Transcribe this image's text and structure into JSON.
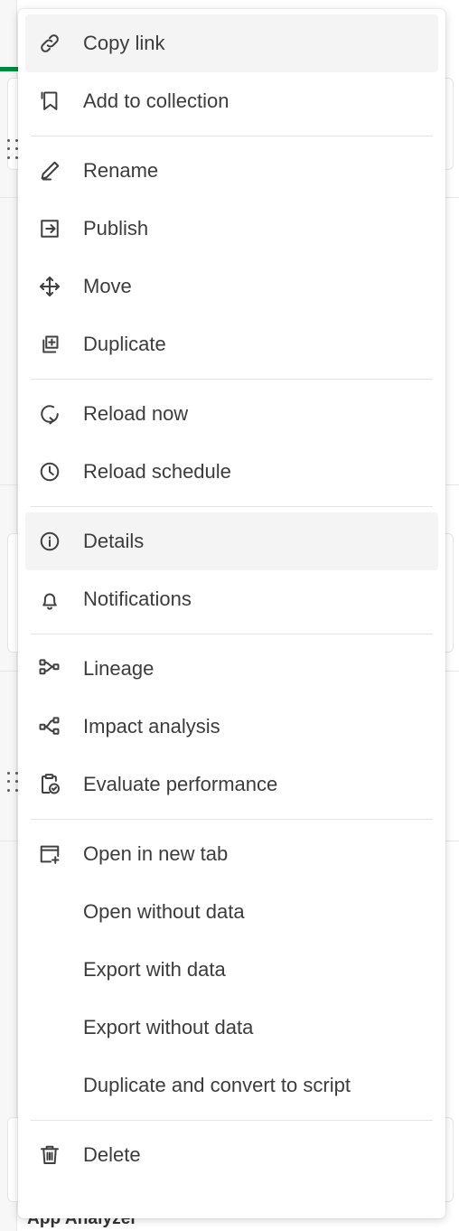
{
  "background": {
    "accent_color": "#00873d",
    "app_title": "App Analyzer",
    "drag_handle_icon": "drag-handle-icon"
  },
  "context_menu": {
    "highlighted_item": "Details",
    "groups": [
      {
        "items": [
          {
            "label": "Copy link",
            "icon": "link-icon",
            "highlighted": true
          },
          {
            "label": "Add to collection",
            "icon": "bookmark-icon",
            "highlighted": false
          }
        ]
      },
      {
        "items": [
          {
            "label": "Rename",
            "icon": "pencil-icon",
            "highlighted": false
          },
          {
            "label": "Publish",
            "icon": "publish-arrow-icon",
            "highlighted": false
          },
          {
            "label": "Move",
            "icon": "move-arrows-icon",
            "highlighted": false
          },
          {
            "label": "Duplicate",
            "icon": "duplicate-plus-icon",
            "highlighted": false
          }
        ]
      },
      {
        "items": [
          {
            "label": "Reload now",
            "icon": "reload-icon",
            "highlighted": false
          },
          {
            "label": "Reload schedule",
            "icon": "clock-icon",
            "highlighted": false
          }
        ]
      },
      {
        "items": [
          {
            "label": "Details",
            "icon": "info-circle-icon",
            "highlighted": true
          },
          {
            "label": "Notifications",
            "icon": "bell-icon",
            "highlighted": false
          }
        ]
      },
      {
        "items": [
          {
            "label": "Lineage",
            "icon": "lineage-icon",
            "highlighted": false
          },
          {
            "label": "Impact analysis",
            "icon": "impact-analysis-icon",
            "highlighted": false
          },
          {
            "label": "Evaluate performance",
            "icon": "clipboard-check-icon",
            "highlighted": false
          }
        ]
      },
      {
        "items": [
          {
            "label": "Open in new tab",
            "icon": "new-tab-icon",
            "highlighted": false
          },
          {
            "label": "Open without data",
            "icon": "",
            "highlighted": false
          },
          {
            "label": "Export with data",
            "icon": "",
            "highlighted": false
          },
          {
            "label": "Export without data",
            "icon": "",
            "highlighted": false
          },
          {
            "label": "Duplicate and convert to script",
            "icon": "",
            "highlighted": false
          }
        ]
      },
      {
        "items": [
          {
            "label": "Delete",
            "icon": "trash-icon",
            "highlighted": false
          }
        ]
      }
    ]
  }
}
